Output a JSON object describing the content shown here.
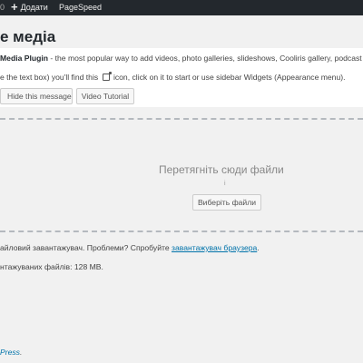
{
  "adminbar": {
    "wp_fragment": "0",
    "add_new_icon": "plus-icon",
    "add_new_label": "Додати",
    "pagespeed_label": "PageSpeed"
  },
  "page_title": "е медіа",
  "notice": {
    "plugin_name": "Media Plugin",
    "line1_rest": " - the most popular way to add videos, photo galleries, slideshows, Cooliris gallery, podcast an",
    "line2_start": "e the text box) you'll find this ",
    "line2_end": " icon, click on it to start or use sidebar Widgets (Appearance menu).",
    "inline_icon": "media-insert-icon",
    "hide_label": "Hide this message",
    "video_label": "Video Tutorial"
  },
  "dropzone": {
    "drop_text": "Перетягніть сюди файли",
    "or_text": "і",
    "select_label": "Виберіть файли"
  },
  "uploader_note": {
    "text_before": "айловий завантажувач. Проблеми? Спробуйте ",
    "link_text": "завантажувач браузера",
    "text_after": "."
  },
  "max_size": "нтажуваних файлів: 128 MB.",
  "footer": {
    "link_text": "Press",
    "text_after": "."
  }
}
